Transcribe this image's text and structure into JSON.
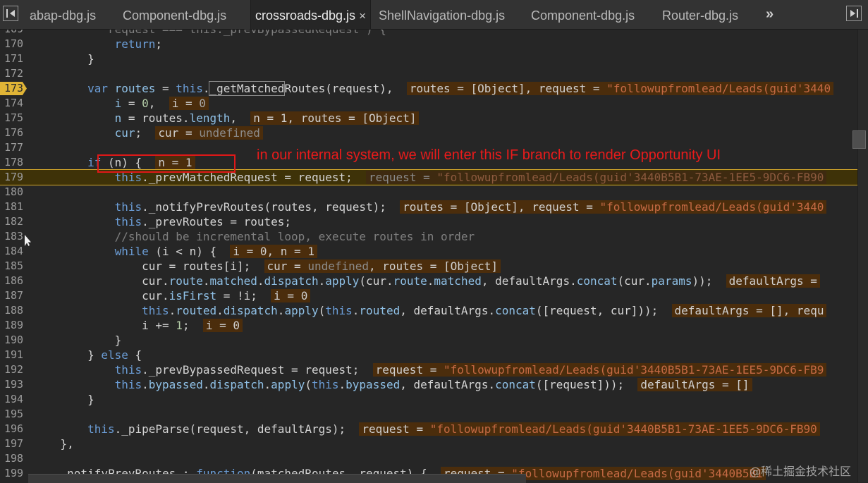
{
  "tabs": [
    {
      "label": "abap-dbg.js"
    },
    {
      "label": "Component-dbg.js"
    },
    {
      "label": "crossroads-dbg.js",
      "active": true,
      "close": "×"
    },
    {
      "label": "ShellNavigation-dbg.js"
    },
    {
      "label": "Component-dbg.js"
    },
    {
      "label": "Router-dbg.js"
    }
  ],
  "tabs_overflow": "»",
  "lines": [
    {
      "n": "169",
      "parts": [
        [
          "s",
          "          'request === this._prevBypassedRequest') {"
        ]
      ]
    },
    {
      "n": "170",
      "parts": [
        [
          "k",
          "            return"
        ],
        [
          "p",
          ";"
        ]
      ]
    },
    {
      "n": "171",
      "parts": [
        [
          "p",
          "        }"
        ]
      ]
    },
    {
      "n": "172",
      "parts": []
    },
    {
      "n": "173",
      "bp": true,
      "parts": [
        [
          "k",
          "        var "
        ],
        [
          "v",
          "routes"
        ],
        [
          "p",
          " = "
        ],
        [
          "k",
          "this"
        ],
        [
          "p",
          "."
        ],
        [
          "b",
          "_getMatched"
        ],
        [
          "p",
          "Routes(request),  "
        ],
        [
          "i",
          "routes = [Object], request = "
        ],
        [
          "is",
          "\"followupfromlead/Leads(guid'3440"
        ]
      ]
    },
    {
      "n": "174",
      "parts": [
        [
          "v",
          "            i"
        ],
        [
          "p",
          " = "
        ],
        [
          "n",
          "0"
        ],
        [
          "p",
          ",  "
        ],
        [
          "i",
          "i = "
        ],
        [
          "in",
          "0"
        ]
      ]
    },
    {
      "n": "175",
      "parts": [
        [
          "v",
          "            n"
        ],
        [
          "p",
          " = routes."
        ],
        [
          "v",
          "length"
        ],
        [
          "p",
          ",  "
        ],
        [
          "i",
          "n = 1, routes = [Object]"
        ]
      ]
    },
    {
      "n": "176",
      "parts": [
        [
          "v",
          "            cur"
        ],
        [
          "p",
          ";  "
        ],
        [
          "i",
          "cur = "
        ],
        [
          "iu",
          "undefined"
        ]
      ]
    },
    {
      "n": "177",
      "parts": []
    },
    {
      "n": "178",
      "parts": [
        [
          "k",
          "        if"
        ],
        [
          "p",
          " (n) {  "
        ],
        [
          "i",
          "n = 1"
        ]
      ]
    },
    {
      "n": "179",
      "paused": true,
      "parts": [
        [
          "k",
          "            this"
        ],
        [
          "p",
          "._prevMatchedRequest = request;  "
        ],
        [
          "f",
          "request = "
        ],
        [
          "fs",
          "\"followupfromlead/Leads(guid'3440B5B1-73AE-1EE5-9DC6-FB90"
        ]
      ]
    },
    {
      "n": "180",
      "parts": []
    },
    {
      "n": "181",
      "parts": [
        [
          "k",
          "            this"
        ],
        [
          "p",
          "._notifyPrevRoutes(routes, request);  "
        ],
        [
          "i",
          "routes = [Object], request = "
        ],
        [
          "is",
          "\"followupfromlead/Leads(guid'3440"
        ]
      ]
    },
    {
      "n": "182",
      "parts": [
        [
          "k",
          "            this"
        ],
        [
          "p",
          "._prevRoutes = routes;"
        ]
      ]
    },
    {
      "n": "183",
      "parts": [
        [
          "c",
          "            //should be incremental loop, execute routes in order"
        ]
      ]
    },
    {
      "n": "184",
      "parts": [
        [
          "k",
          "            while"
        ],
        [
          "p",
          " (i < n) {  "
        ],
        [
          "i",
          "i = 0, n = 1"
        ]
      ]
    },
    {
      "n": "185",
      "parts": [
        [
          "p",
          "                cur = routes[i];  "
        ],
        [
          "i",
          "cur = "
        ],
        [
          "iu",
          "undefined"
        ],
        [
          "i",
          ", routes = [Object]"
        ]
      ]
    },
    {
      "n": "186",
      "parts": [
        [
          "p",
          "                cur."
        ],
        [
          "v",
          "route"
        ],
        [
          "p",
          "."
        ],
        [
          "v",
          "matched"
        ],
        [
          "p",
          "."
        ],
        [
          "v",
          "dispatch"
        ],
        [
          "p",
          "."
        ],
        [
          "v",
          "apply"
        ],
        [
          "p",
          "(cur."
        ],
        [
          "v",
          "route"
        ],
        [
          "p",
          "."
        ],
        [
          "v",
          "matched"
        ],
        [
          "p",
          ", defaultArgs."
        ],
        [
          "v",
          "concat"
        ],
        [
          "p",
          "(cur."
        ],
        [
          "v",
          "params"
        ],
        [
          "p",
          "));  "
        ],
        [
          "i",
          "defaultArgs ="
        ]
      ]
    },
    {
      "n": "187",
      "parts": [
        [
          "p",
          "                cur."
        ],
        [
          "v",
          "isFirst"
        ],
        [
          "p",
          " = !i;  "
        ],
        [
          "i",
          "i = 0"
        ]
      ]
    },
    {
      "n": "188",
      "parts": [
        [
          "k",
          "                this"
        ],
        [
          "p",
          "."
        ],
        [
          "v",
          "routed"
        ],
        [
          "p",
          "."
        ],
        [
          "v",
          "dispatch"
        ],
        [
          "p",
          "."
        ],
        [
          "v",
          "apply"
        ],
        [
          "p",
          "("
        ],
        [
          "k",
          "this"
        ],
        [
          "p",
          "."
        ],
        [
          "v",
          "routed"
        ],
        [
          "p",
          ", defaultArgs."
        ],
        [
          "v",
          "concat"
        ],
        [
          "p",
          "([request, cur]));  "
        ],
        [
          "i",
          "defaultArgs = [], requ"
        ]
      ]
    },
    {
      "n": "189",
      "parts": [
        [
          "p",
          "                i += "
        ],
        [
          "n",
          "1"
        ],
        [
          "p",
          ";  "
        ],
        [
          "i",
          "i = 0"
        ]
      ]
    },
    {
      "n": "190",
      "parts": [
        [
          "p",
          "            }"
        ]
      ]
    },
    {
      "n": "191",
      "parts": [
        [
          "p",
          "        } "
        ],
        [
          "k",
          "else"
        ],
        [
          "p",
          " {"
        ]
      ]
    },
    {
      "n": "192",
      "parts": [
        [
          "k",
          "            this"
        ],
        [
          "p",
          "._prevBypassedRequest = request;  "
        ],
        [
          "i",
          "request = "
        ],
        [
          "is",
          "\"followupfromlead/Leads(guid'3440B5B1-73AE-1EE5-9DC6-FB9"
        ]
      ]
    },
    {
      "n": "193",
      "parts": [
        [
          "k",
          "            this"
        ],
        [
          "p",
          "."
        ],
        [
          "v",
          "bypassed"
        ],
        [
          "p",
          "."
        ],
        [
          "v",
          "dispatch"
        ],
        [
          "p",
          "."
        ],
        [
          "v",
          "apply"
        ],
        [
          "p",
          "("
        ],
        [
          "k",
          "this"
        ],
        [
          "p",
          "."
        ],
        [
          "v",
          "bypassed"
        ],
        [
          "p",
          ", defaultArgs."
        ],
        [
          "v",
          "concat"
        ],
        [
          "p",
          "([request]));  "
        ],
        [
          "i",
          "defaultArgs = []"
        ]
      ]
    },
    {
      "n": "194",
      "parts": [
        [
          "p",
          "        }"
        ]
      ]
    },
    {
      "n": "195",
      "parts": []
    },
    {
      "n": "196",
      "parts": [
        [
          "k",
          "        this"
        ],
        [
          "p",
          "._pipeParse(request, defaultArgs);  "
        ],
        [
          "i",
          "request = "
        ],
        [
          "is",
          "\"followupfromlead/Leads(guid'3440B5B1-73AE-1EE5-9DC6-FB90"
        ]
      ]
    },
    {
      "n": "197",
      "parts": [
        [
          "p",
          "    },"
        ]
      ]
    },
    {
      "n": "198",
      "parts": []
    },
    {
      "n": "199",
      "parts": [
        [
          "p",
          "    _notifyPrevRoutes : "
        ],
        [
          "k",
          "function"
        ],
        [
          "p",
          "(matchedRoutes, request) {  "
        ],
        [
          "i",
          "request = "
        ],
        [
          "is",
          "\"followupfromlead/Leads(guid'3440B5B1"
        ]
      ]
    }
  ],
  "annotation": "in our internal system, we will enter this IF branch to render Opportunity UI",
  "watermark": "@稀土掘金技术社区",
  "colors": {
    "breakpoint": "#e0b436",
    "annotation": "#e01818",
    "paused_line": "#3e3208"
  }
}
